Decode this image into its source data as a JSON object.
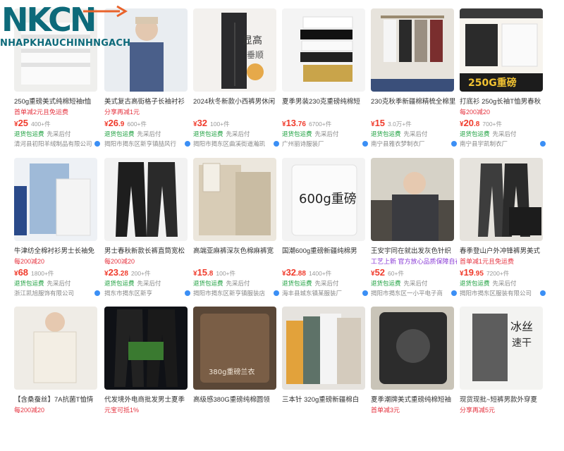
{
  "logo": {
    "main": "NKCN",
    "sub": "NHAPKHAUCHINHNGACH"
  },
  "colors": {
    "price": "#f03b2c",
    "promo": "#e5333f",
    "green": "#1a9f3c",
    "logo": "#0d6a7a"
  },
  "products": [
    {
      "title": "250g重磅美式纯棉短袖t恤",
      "promo": "首单减2元且免运费",
      "price_int": "25",
      "price_dec": "",
      "sold": "400+件",
      "tags": [
        "退货包运费",
        "先采后付"
      ],
      "shop": "清河县初阳羊绒制品有限公司"
    },
    {
      "title": "美式复古高街格子长袖衬衫",
      "promo": "分享再减1元",
      "price_int": "26",
      "price_dec": ".9",
      "sold": "600+件",
      "tags": [
        "退货包运费",
        "先采后付"
      ],
      "shop": "揭阳市揭东区新亨镇喆风行"
    },
    {
      "title": "2024秋冬新款小西裤男休闲",
      "promo": "",
      "price_int": "32",
      "price_dec": "",
      "sold": "100+件",
      "tags": [
        "退货包运费",
        "先采后付"
      ],
      "shop": "揭阳市揭东区曲溪街道瀚凯"
    },
    {
      "title": "夏季男装230克重磅纯棉短",
      "promo": "",
      "price_int": "13",
      "price_dec": ".76",
      "sold": "6700+件",
      "tags": [
        "退货包运费",
        "先采后付"
      ],
      "shop": "广州丽诗服装厂"
    },
    {
      "title": "230克秋季新疆棉精梳全棉里",
      "promo": "",
      "price_int": "15",
      "price_dec": "",
      "sold": "3.0万+件",
      "tags": [
        "退货包运费",
        "先采后付"
      ],
      "shop": "南宁县雅衣梦制衣厂"
    },
    {
      "title": "打底衫 250g长袖T恤男春秋",
      "promo": "每200减20",
      "price_int": "20",
      "price_dec": ".8",
      "sold": "700+件",
      "tags": [
        "退货包运费",
        "先采后付"
      ],
      "shop": "南宁县宇凯制衣厂"
    },
    {
      "title": "牛津纺全棉衬衫男士长袖免",
      "promo": "每200减20",
      "price_int": "68",
      "price_dec": "",
      "sold": "1800+件",
      "tags": [
        "退货包运费",
        "先采后付"
      ],
      "shop": "浙江凯旭服饰有限公司"
    },
    {
      "title": "男士春秋新款长裤直筒宽松",
      "promo": "每200减20",
      "price_int": "23",
      "price_dec": ".28",
      "sold": "200+件",
      "tags": [
        "退货包运费",
        "先采后付"
      ],
      "shop": "揭东市揭东区新亨"
    },
    {
      "title": "高端亚麻裤深灰色棉麻裤宽",
      "promo": "",
      "price_int": "15",
      "price_dec": ".8",
      "sold": "100+件",
      "tags": [
        "退货包运费",
        "先采后付"
      ],
      "shop": "揭阳市揭东区新亨镇服装店"
    },
    {
      "title": "国潮600g重磅新疆纯棉男",
      "promo": "",
      "price_int": "32",
      "price_dec": ".88",
      "sold": "1400+件",
      "tags": [
        "退货包运费",
        "先采后付"
      ],
      "shop": "海丰县城东镇某服装厂"
    },
    {
      "title": "王安宇同在就出发灰色针织",
      "promo": "工艺上新 官方放心品质保障自在",
      "price_int": "52",
      "price_dec": "",
      "sold": "60+件",
      "tags": [
        "退货包运费",
        "先采后付"
      ],
      "shop": "揭阳市揭东区一小平电子商"
    },
    {
      "title": "春季登山户外冲锋裤男美式",
      "promo": "首单减1元且免运费",
      "price_int": "19",
      "price_dec": ".95",
      "sold": "7200+件",
      "tags": [
        "退货包运费",
        "先采后付"
      ],
      "shop": "揭阳市揭东区服装有限公司"
    },
    {
      "title": "【含桑蚕丝】7A抗菌T恤情",
      "promo": "每200减20",
      "price_int": "",
      "price_dec": "",
      "sold": "",
      "tags": [],
      "shop": ""
    },
    {
      "title": "代发境外电商批发男士夏季",
      "promo": "元宝可抵1%",
      "price_int": "",
      "price_dec": "",
      "sold": "",
      "tags": [],
      "shop": ""
    },
    {
      "title": "高级感380G重磅纯棉圆领",
      "promo": "",
      "price_int": "",
      "price_dec": "",
      "sold": "",
      "tags": [],
      "shop": ""
    },
    {
      "title": "三本针 320g重磅新疆棉白",
      "promo": "",
      "price_int": "",
      "price_dec": "",
      "sold": "",
      "tags": [],
      "shop": ""
    },
    {
      "title": "夏季潮牌美式重磅纯棉短袖",
      "promo": "首单减3元",
      "price_int": "",
      "price_dec": "",
      "sold": "",
      "tags": [],
      "shop": ""
    },
    {
      "title": "现货现批~短裤男款外穿夏",
      "promo": "分享再减5元",
      "price_int": "",
      "price_dec": "",
      "sold": "",
      "tags": [],
      "shop": ""
    }
  ]
}
